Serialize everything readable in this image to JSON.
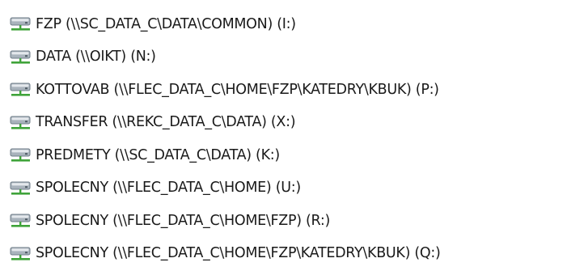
{
  "drives": [
    {
      "label": "FZP (\\\\SC_DATA_C\\DATA\\COMMON) (I:)",
      "icon": "network-drive-icon"
    },
    {
      "label": "DATA (\\\\OIKT) (N:)",
      "icon": "network-drive-icon"
    },
    {
      "label": "KOTTOVAB (\\\\FLEC_DATA_C\\HOME\\FZP\\KATEDRY\\KBUK) (P:)",
      "icon": "network-drive-icon"
    },
    {
      "label": "TRANSFER (\\\\REKC_DATA_C\\DATA) (X:)",
      "icon": "network-drive-icon"
    },
    {
      "label": "PREDMETY (\\\\SC_DATA_C\\DATA) (K:)",
      "icon": "network-drive-icon"
    },
    {
      "label": "SPOLECNY (\\\\FLEC_DATA_C\\HOME) (U:)",
      "icon": "network-drive-icon"
    },
    {
      "label": "SPOLECNY (\\\\FLEC_DATA_C\\HOME\\FZP) (R:)",
      "icon": "network-drive-icon"
    },
    {
      "label": "SPOLECNY (\\\\FLEC_DATA_C\\HOME\\FZP\\KATEDRY\\KBUK) (Q:)",
      "icon": "network-drive-icon"
    }
  ],
  "colors": {
    "drive_body": "#a9b3bc",
    "drive_top": "#e4e8ec",
    "cable": "#3fa33a"
  }
}
